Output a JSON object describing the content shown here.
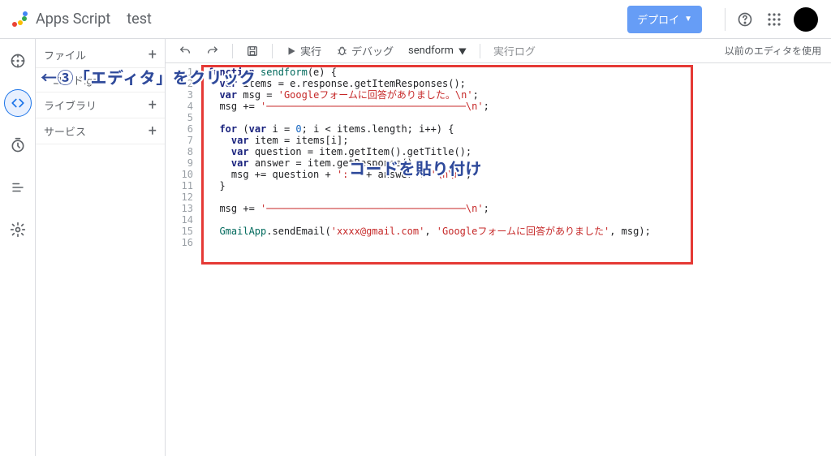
{
  "header": {
    "app_name": "Apps Script",
    "project_name": "test",
    "deploy_label": "デプロイ"
  },
  "sidebar": {
    "file_section": "ファイル",
    "file_name": "コード.gs",
    "library_section": "ライブラリ",
    "service_section": "サービス"
  },
  "toolbar": {
    "run": "実行",
    "debug": "デバッグ",
    "function": "sendform",
    "log": "実行ログ",
    "legacy": "以前のエディタを使用"
  },
  "code": {
    "lines": [
      {
        "n": 1,
        "segs": [
          [
            "kw",
            "function"
          ],
          [
            "pln",
            " "
          ],
          [
            "typ",
            "sendform"
          ],
          [
            "pln",
            "(e) {"
          ]
        ]
      },
      {
        "n": 2,
        "segs": [
          [
            "pln",
            "  "
          ],
          [
            "kw",
            "var"
          ],
          [
            "pln",
            " items = e.response.getItemResponses();"
          ]
        ]
      },
      {
        "n": 3,
        "segs": [
          [
            "pln",
            "  "
          ],
          [
            "kw",
            "var"
          ],
          [
            "pln",
            " msg = "
          ],
          [
            "str",
            "'Googleフォームに回答がありました。\\n'"
          ],
          [
            "pln",
            ";"
          ]
        ]
      },
      {
        "n": 4,
        "segs": [
          [
            "pln",
            "  msg += "
          ],
          [
            "str",
            "'──────────────────────────────────\\n'"
          ],
          [
            "pln",
            ";"
          ]
        ]
      },
      {
        "n": 5,
        "segs": []
      },
      {
        "n": 6,
        "segs": [
          [
            "pln",
            "  "
          ],
          [
            "kw",
            "for"
          ],
          [
            "pln",
            " ("
          ],
          [
            "kw",
            "var"
          ],
          [
            "pln",
            " i = "
          ],
          [
            "num",
            "0"
          ],
          [
            "pln",
            "; i < items.length; i++) {"
          ]
        ]
      },
      {
        "n": 7,
        "segs": [
          [
            "pln",
            "    "
          ],
          [
            "kw",
            "var"
          ],
          [
            "pln",
            " item = items[i];"
          ]
        ]
      },
      {
        "n": 8,
        "segs": [
          [
            "pln",
            "    "
          ],
          [
            "kw",
            "var"
          ],
          [
            "pln",
            " question = item.getItem().getTitle();"
          ]
        ]
      },
      {
        "n": 9,
        "segs": [
          [
            "pln",
            "    "
          ],
          [
            "kw",
            "var"
          ],
          [
            "pln",
            " answer = item.getResponse();"
          ]
        ]
      },
      {
        "n": 10,
        "segs": [
          [
            "pln",
            "    msg += question + "
          ],
          [
            "str",
            "': '"
          ],
          [
            "pln",
            " + answer + "
          ],
          [
            "str",
            "'\\n\\n'"
          ],
          [
            "pln",
            ";"
          ]
        ]
      },
      {
        "n": 11,
        "segs": [
          [
            "pln",
            "  }"
          ]
        ]
      },
      {
        "n": 12,
        "segs": []
      },
      {
        "n": 13,
        "segs": [
          [
            "pln",
            "  msg += "
          ],
          [
            "str",
            "'──────────────────────────────────\\n'"
          ],
          [
            "pln",
            ";"
          ]
        ]
      },
      {
        "n": 14,
        "segs": []
      },
      {
        "n": 15,
        "segs": [
          [
            "pln",
            "  "
          ],
          [
            "typ",
            "GmailApp"
          ],
          [
            "pln",
            ".sendEmail("
          ],
          [
            "str",
            "'xxxx@gmail.com'"
          ],
          [
            "pln",
            ", "
          ],
          [
            "str",
            "'Googleフォームに回答がありました'"
          ],
          [
            "pln",
            ", msg);"
          ]
        ]
      },
      {
        "n": 16,
        "segs": []
      }
    ]
  },
  "annotations": {
    "a1": "←③「エディタ」をクリック",
    "a2": "コードを貼り付け"
  }
}
